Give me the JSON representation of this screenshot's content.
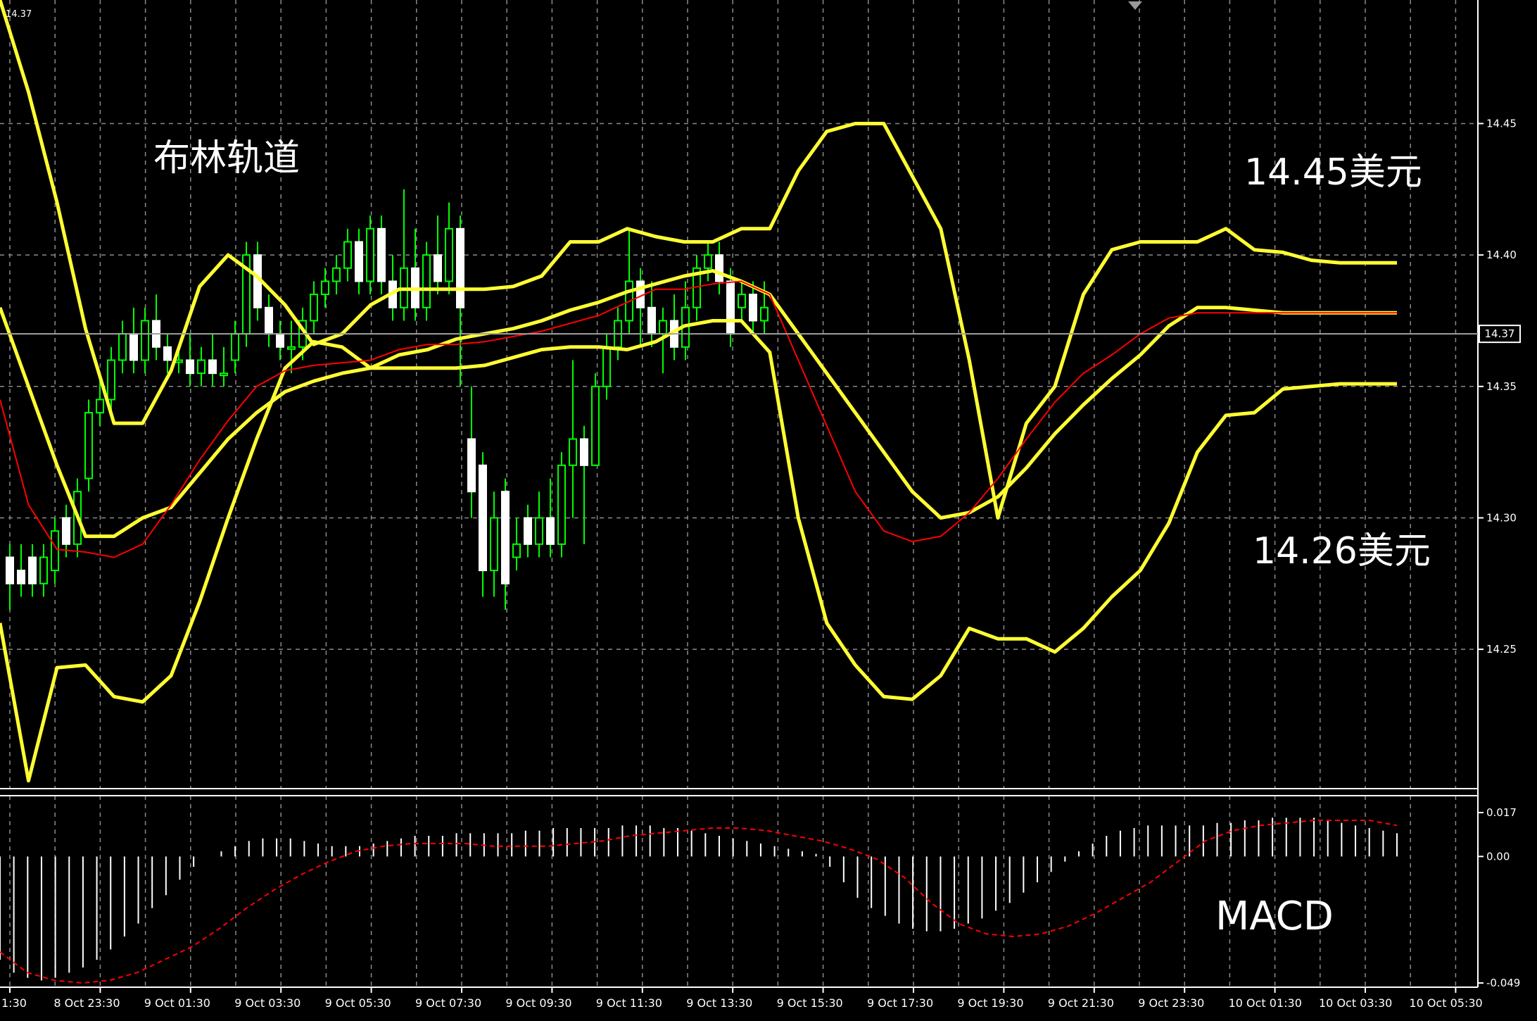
{
  "price_tag_topleft": "14.37",
  "chart_data": [
    {
      "type": "candlestick",
      "panel": "main",
      "annotations": [
        "布林轨道",
        "14.45美元",
        "14.26美元"
      ],
      "y_ticks": [
        "14.45",
        "14.40",
        "14.35",
        "14.30",
        "14.25"
      ],
      "current_price": "14.37",
      "ylim": [
        14.197,
        14.497
      ],
      "x_tick_labels": [
        "1:30",
        "8 Oct 23:30",
        "9 Oct 01:30",
        "9 Oct 03:30",
        "9 Oct 05:30",
        "9 Oct 07:30",
        "9 Oct 09:30",
        "9 Oct 11:30",
        "9 Oct 13:30",
        "9 Oct 15:30",
        "9 Oct 17:30",
        "9 Oct 19:30",
        "9 Oct 21:30",
        "9 Oct 23:30",
        "10 Oct 01:30",
        "10 Oct 03:30",
        "10 Oct 05:30"
      ],
      "grid": true,
      "colors": {
        "background": "#000000",
        "bull_candle": "#00ff00",
        "bear_candle": "#ffffff",
        "bollinger": "#ffff33",
        "signal_ma": "#ff0000",
        "grid": "#8a8a8a",
        "axis_text": "#ffffff",
        "current_price_line": "#a0a0a0"
      },
      "series": [
        {
          "values": [
            14.497,
            14.462,
            14.42,
            14.372,
            14.336,
            14.336,
            14.356,
            14.388,
            14.4,
            14.392,
            14.381,
            14.366,
            14.37,
            14.381,
            14.387,
            14.387,
            14.387,
            14.387,
            14.388,
            14.392,
            14.405,
            14.405,
            14.41,
            14.407,
            14.405,
            14.405,
            14.41,
            14.41,
            14.432,
            14.447,
            14.45,
            14.45,
            14.43,
            14.41,
            14.36,
            14.3,
            14.336,
            14.35,
            14.385,
            14.402,
            14.405,
            14.405,
            14.405,
            14.41,
            14.402,
            14.401,
            14.398,
            14.397,
            14.397,
            14.397
          ]
        },
        {
          "values": [
            14.38,
            14.35,
            14.32,
            14.293,
            14.293,
            14.3,
            14.304,
            14.317,
            14.33,
            14.34,
            14.348,
            14.352,
            14.355,
            14.357,
            14.362,
            14.364,
            14.368,
            14.37,
            14.372,
            14.375,
            14.379,
            14.382,
            14.386,
            14.389,
            14.392,
            14.394,
            14.39,
            14.385,
            14.37,
            14.355,
            14.34,
            14.325,
            14.31,
            14.3,
            14.302,
            14.308,
            14.319,
            14.332,
            14.343,
            14.353,
            14.362,
            14.373,
            14.38,
            14.38,
            14.379,
            14.378,
            14.378,
            14.378,
            14.378,
            14.378
          ]
        },
        {
          "values": [
            14.26,
            14.2,
            14.243,
            14.244,
            14.232,
            14.23,
            14.24,
            14.268,
            14.3,
            14.33,
            14.357,
            14.367,
            14.365,
            14.357,
            14.357,
            14.357,
            14.357,
            14.358,
            14.361,
            14.364,
            14.365,
            14.365,
            14.364,
            14.367,
            14.373,
            14.375,
            14.375,
            14.363,
            14.3,
            14.26,
            14.244,
            14.232,
            14.231,
            14.24,
            14.258,
            14.254,
            14.254,
            14.249,
            14.258,
            14.27,
            14.28,
            14.298,
            14.325,
            14.339,
            14.34,
            14.349,
            14.35,
            14.351,
            14.351,
            14.351
          ]
        },
        {
          "values": [
            14.345,
            14.305,
            14.288,
            14.287,
            14.285,
            14.29,
            14.305,
            14.322,
            14.337,
            14.35,
            14.356,
            14.358,
            14.359,
            14.36,
            14.364,
            14.366,
            14.366,
            14.367,
            14.369,
            14.371,
            14.374,
            14.377,
            14.382,
            14.387,
            14.387,
            14.389,
            14.39,
            14.385,
            14.36,
            14.335,
            14.31,
            14.295,
            14.291,
            14.293,
            14.302,
            14.315,
            14.33,
            14.344,
            14.355,
            14.362,
            14.37,
            14.376,
            14.378,
            14.378,
            14.378,
            14.378,
            14.378,
            14.378,
            14.378,
            14.378
          ]
        }
      ],
      "candles": [
        [
          14.285,
          14.275,
          14.29,
          14.265
        ],
        [
          14.28,
          14.275,
          14.29,
          14.27
        ],
        [
          14.285,
          14.275,
          14.29,
          14.27
        ],
        [
          14.275,
          14.285,
          14.29,
          14.27
        ],
        [
          14.28,
          14.295,
          14.3,
          14.275
        ],
        [
          14.3,
          14.29,
          14.305,
          14.285
        ],
        [
          14.29,
          14.31,
          14.315,
          14.285
        ],
        [
          14.315,
          14.34,
          14.345,
          14.31
        ],
        [
          14.34,
          14.345,
          14.355,
          14.335
        ],
        [
          14.345,
          14.36,
          14.365,
          14.34
        ],
        [
          14.36,
          14.37,
          14.375,
          14.355
        ],
        [
          14.37,
          14.36,
          14.38,
          14.355
        ],
        [
          14.36,
          14.375,
          14.38,
          14.355
        ],
        [
          14.375,
          14.365,
          14.385,
          14.36
        ],
        [
          14.365,
          14.36,
          14.37,
          14.355
        ],
        [
          14.36,
          14.36,
          14.365,
          14.355
        ],
        [
          14.36,
          14.355,
          14.37,
          14.35
        ],
        [
          14.355,
          14.36,
          14.365,
          14.35
        ],
        [
          14.36,
          14.355,
          14.37,
          14.35
        ],
        [
          14.355,
          14.355,
          14.365,
          14.35
        ],
        [
          14.36,
          14.37,
          14.375,
          14.355
        ],
        [
          14.37,
          14.4,
          14.405,
          14.365
        ],
        [
          14.4,
          14.38,
          14.405,
          14.375
        ],
        [
          14.38,
          14.37,
          14.385,
          14.365
        ],
        [
          14.37,
          14.365,
          14.375,
          14.36
        ],
        [
          14.365,
          14.365,
          14.375,
          14.355
        ],
        [
          14.365,
          14.375,
          14.38,
          14.36
        ],
        [
          14.375,
          14.385,
          14.39,
          14.37
        ],
        [
          14.385,
          14.39,
          14.395,
          14.38
        ],
        [
          14.39,
          14.395,
          14.4,
          14.385
        ],
        [
          14.395,
          14.405,
          14.41,
          14.39
        ],
        [
          14.405,
          14.39,
          14.41,
          14.385
        ],
        [
          14.39,
          14.41,
          14.415,
          14.385
        ],
        [
          14.41,
          14.39,
          14.415,
          14.385
        ],
        [
          14.39,
          14.38,
          14.4,
          14.375
        ],
        [
          14.38,
          14.395,
          14.425,
          14.375
        ],
        [
          14.395,
          14.38,
          14.41,
          14.375
        ],
        [
          14.38,
          14.4,
          14.405,
          14.375
        ],
        [
          14.4,
          14.39,
          14.415,
          14.385
        ],
        [
          14.39,
          14.41,
          14.42,
          14.385
        ],
        [
          14.41,
          14.38,
          14.415,
          14.35
        ],
        [
          14.33,
          14.31,
          14.35,
          14.3
        ],
        [
          14.32,
          14.28,
          14.325,
          14.27
        ],
        [
          14.28,
          14.3,
          14.31,
          14.27
        ],
        [
          14.31,
          14.275,
          14.315,
          14.265
        ],
        [
          14.285,
          14.29,
          14.3,
          14.28
        ],
        [
          14.3,
          14.29,
          14.305,
          14.285
        ],
        [
          14.29,
          14.3,
          14.31,
          14.285
        ],
        [
          14.3,
          14.29,
          14.315,
          14.285
        ],
        [
          14.29,
          14.32,
          14.325,
          14.285
        ],
        [
          14.32,
          14.33,
          14.36,
          14.3
        ],
        [
          14.33,
          14.32,
          14.335,
          14.29
        ],
        [
          14.32,
          14.35,
          14.355,
          14.32
        ],
        [
          14.35,
          14.365,
          14.37,
          14.345
        ],
        [
          14.365,
          14.375,
          14.38,
          14.36
        ],
        [
          14.375,
          14.39,
          14.41,
          14.37
        ],
        [
          14.39,
          14.38,
          14.395,
          14.365
        ],
        [
          14.38,
          14.37,
          14.39,
          14.365
        ],
        [
          14.37,
          14.375,
          14.38,
          14.355
        ],
        [
          14.375,
          14.365,
          14.385,
          14.36
        ],
        [
          14.365,
          14.38,
          14.39,
          14.36
        ],
        [
          14.38,
          14.395,
          14.4,
          14.375
        ],
        [
          14.395,
          14.4,
          14.405,
          14.39
        ],
        [
          14.4,
          14.39,
          14.405,
          14.385
        ],
        [
          14.39,
          14.37,
          14.395,
          14.365
        ],
        [
          14.38,
          14.385,
          14.39,
          14.375
        ],
        [
          14.385,
          14.375,
          14.39,
          14.37
        ],
        [
          14.375,
          14.38,
          14.39,
          14.37
        ]
      ],
      "description_of_bands": "upper band, middle band, lower band, red moving average"
    },
    {
      "type": "bar+line",
      "panel": "MACD",
      "title": "MACD",
      "y_ticks": [
        "0.017",
        "0.00",
        "-0.049"
      ],
      "ylim": [
        -0.049,
        0.017
      ],
      "colors": {
        "histogram": "#ffffff",
        "signal": "#ff0000"
      },
      "histogram": [
        -0.04,
        -0.045,
        -0.047,
        -0.048,
        -0.047,
        -0.045,
        -0.043,
        -0.04,
        -0.036,
        -0.031,
        -0.026,
        -0.02,
        -0.015,
        -0.009,
        -0.004,
        0.0,
        0.002,
        0.004,
        0.006,
        0.007,
        0.007,
        0.007,
        0.006,
        0.005,
        0.004,
        0.004,
        0.004,
        0.005,
        0.006,
        0.007,
        0.008,
        0.008,
        0.008,
        0.009,
        0.009,
        0.009,
        0.009,
        0.009,
        0.01,
        0.01,
        0.011,
        0.011,
        0.011,
        0.011,
        0.011,
        0.012,
        0.012,
        0.012,
        0.011,
        0.011,
        0.01,
        0.009,
        0.008,
        0.007,
        0.006,
        0.005,
        0.004,
        0.003,
        0.002,
        0.001,
        -0.004,
        -0.01,
        -0.016,
        -0.02,
        -0.023,
        -0.026,
        -0.028,
        -0.029,
        -0.029,
        -0.028,
        -0.026,
        -0.024,
        -0.021,
        -0.018,
        -0.014,
        -0.01,
        -0.006,
        -0.002,
        0.002,
        0.005,
        0.008,
        0.01,
        0.011,
        0.012,
        0.012,
        0.012,
        0.012,
        0.012,
        0.013,
        0.013,
        0.014,
        0.014,
        0.015,
        0.015,
        0.015,
        0.015,
        0.014,
        0.013,
        0.012,
        0.011,
        0.01,
        0.009
      ],
      "signal": [
        -0.037,
        -0.045,
        -0.048,
        -0.049,
        -0.048,
        -0.045,
        -0.04,
        -0.035,
        -0.028,
        -0.02,
        -0.013,
        -0.007,
        -0.002,
        0.002,
        0.004,
        0.005,
        0.005,
        0.005,
        0.004,
        0.004,
        0.004,
        0.005,
        0.006,
        0.008,
        0.009,
        0.01,
        0.011,
        0.011,
        0.01,
        0.008,
        0.006,
        0.003,
        -0.001,
        -0.008,
        -0.018,
        -0.026,
        -0.03,
        -0.031,
        -0.03,
        -0.027,
        -0.022,
        -0.016,
        -0.01,
        -0.002,
        0.006,
        0.01,
        0.012,
        0.013,
        0.014,
        0.014,
        0.014,
        0.012
      ],
      "x_tick_labels": [
        "1:30",
        "8 Oct 23:30",
        "9 Oct 01:30",
        "9 Oct 03:30",
        "9 Oct 05:30",
        "9 Oct 07:30",
        "9 Oct 09:30",
        "9 Oct 11:30",
        "9 Oct 13:30",
        "9 Oct 15:30",
        "9 Oct 17:30",
        "9 Oct 19:30",
        "9 Oct 21:30",
        "9 Oct 23:30",
        "10 Oct 01:30",
        "10 Oct 03:30",
        "10 Oct 05:30"
      ]
    }
  ]
}
